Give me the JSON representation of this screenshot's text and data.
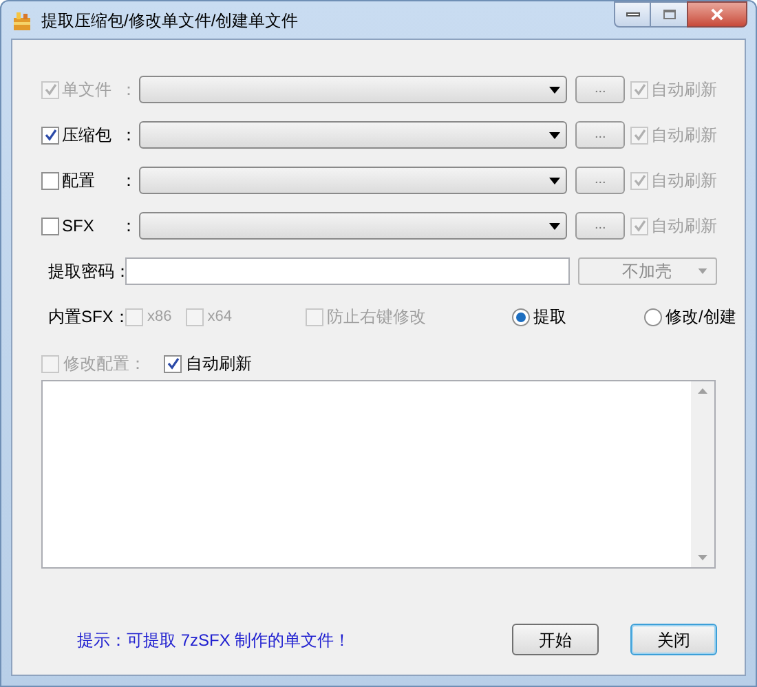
{
  "window": {
    "title": "提取压缩包/修改单文件/创建单文件"
  },
  "file_rows": [
    {
      "label": "单文件",
      "colon": "：",
      "checked": true,
      "disabled": true,
      "browse": "...",
      "auto_refresh": {
        "label": "自动刷新",
        "checked": true,
        "disabled": true
      }
    },
    {
      "label": "压缩包",
      "colon": "：",
      "checked": true,
      "disabled": false,
      "browse": "...",
      "auto_refresh": {
        "label": "自动刷新",
        "checked": true,
        "disabled": true
      }
    },
    {
      "label": "配置",
      "colon": "：",
      "checked": false,
      "disabled": false,
      "browse": "...",
      "auto_refresh": {
        "label": "自动刷新",
        "checked": true,
        "disabled": true
      }
    },
    {
      "label": "SFX",
      "colon": "：",
      "checked": false,
      "disabled": false,
      "browse": "...",
      "auto_refresh": {
        "label": "自动刷新",
        "checked": true,
        "disabled": true
      }
    }
  ],
  "password": {
    "label": "提取密码：",
    "shell": {
      "value": "不加壳",
      "disabled": true
    }
  },
  "options": {
    "label": "内置SFX：",
    "checks": [
      {
        "label": "x86",
        "checked": false,
        "disabled": true
      },
      {
        "label": "x64",
        "checked": false,
        "disabled": true
      },
      {
        "label": "防止右键修改",
        "checked": false,
        "disabled": true
      }
    ],
    "modes": [
      {
        "label": "提取",
        "selected": true
      },
      {
        "label": "修改/创建",
        "selected": false
      }
    ]
  },
  "config_row": [
    {
      "label": "修改配置：",
      "checked": false,
      "disabled": true
    },
    {
      "label": "自动刷新",
      "checked": true,
      "disabled": false
    }
  ],
  "hint": "提示：可提取 7zSFX 制作的单文件！",
  "buttons": [
    {
      "label": "开始",
      "focused": false
    },
    {
      "label": "关闭",
      "focused": true
    }
  ]
}
